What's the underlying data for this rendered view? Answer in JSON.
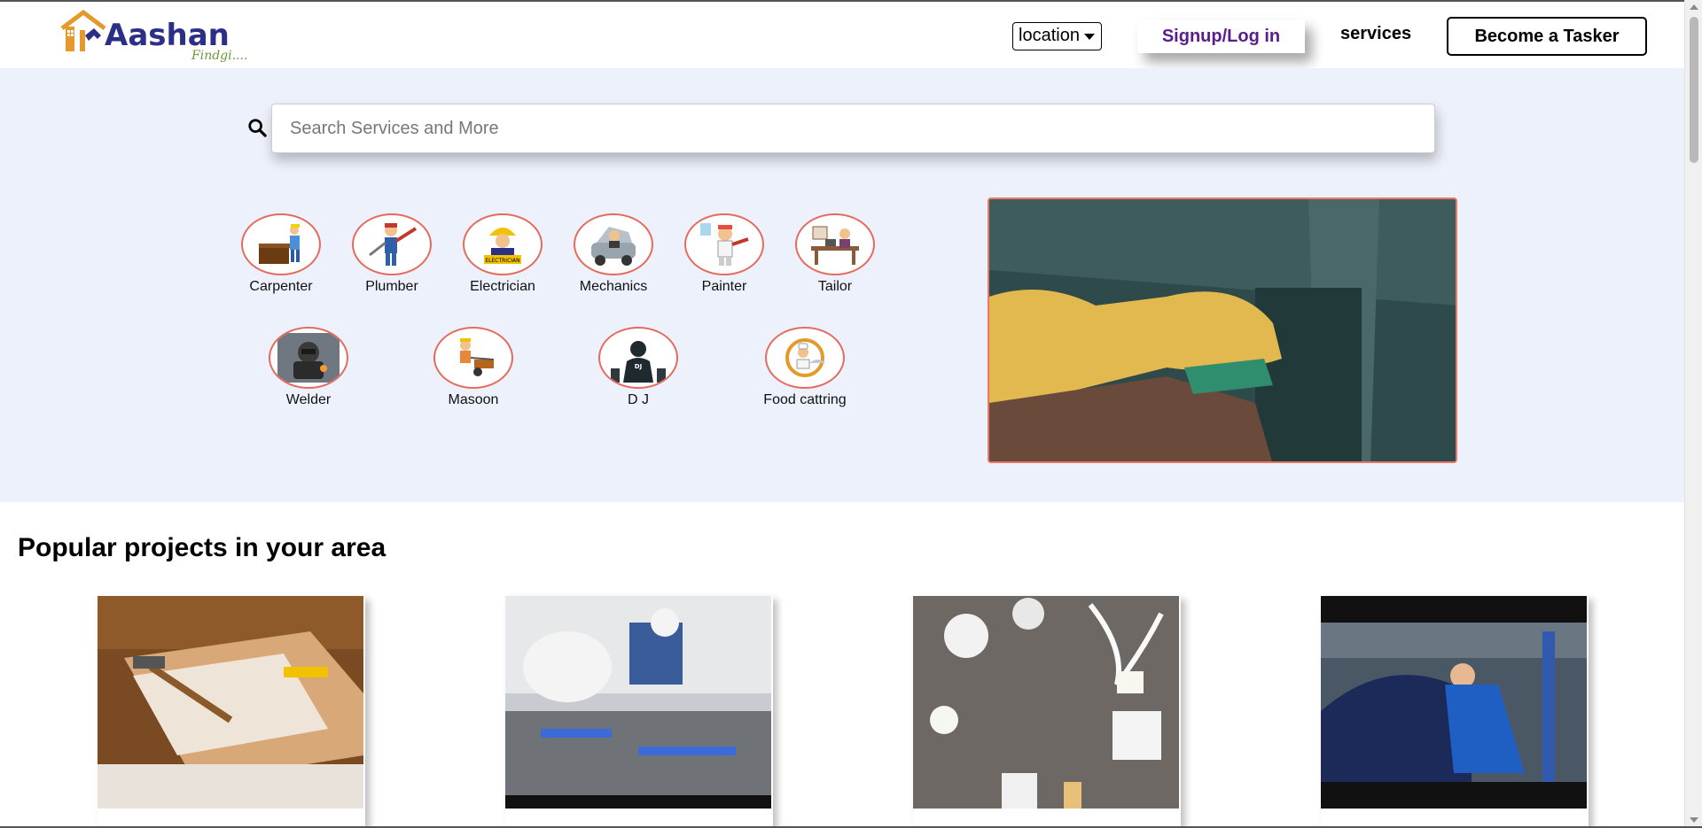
{
  "header": {
    "logo": {
      "name": "Aashan",
      "tagline": "Findgi...."
    },
    "location_label": "location",
    "signup_label": "Signup/Log in",
    "services_label": "services",
    "become_tasker_label": "Become a Tasker"
  },
  "search": {
    "placeholder": "Search Services and More",
    "icon": "search-icon"
  },
  "categories": [
    {
      "label": "Carpenter",
      "icon": "carpenter-icon"
    },
    {
      "label": "Plumber",
      "icon": "plumber-icon"
    },
    {
      "label": "Electrician",
      "icon": "electrician-icon"
    },
    {
      "label": "Mechanics",
      "icon": "mechanic-icon"
    },
    {
      "label": "Painter",
      "icon": "painter-icon"
    },
    {
      "label": "Tailor",
      "icon": "tailor-icon"
    },
    {
      "label": "Welder",
      "icon": "welder-icon"
    },
    {
      "label": "Masoon",
      "icon": "mason-icon"
    },
    {
      "label": "D J",
      "icon": "dj-icon"
    },
    {
      "label": "Food cattring",
      "icon": "food-catering-icon"
    }
  ],
  "popular": {
    "title": "Popular projects in your area",
    "projects": [
      {
        "image": "carpentry-tools-photo"
      },
      {
        "image": "plumber-at-work-photo"
      },
      {
        "image": "electrical-supplies-photo"
      },
      {
        "image": "car-mechanic-photo"
      }
    ]
  },
  "colors": {
    "brand_navy": "#2b2f86",
    "brand_green": "#6c9a3c",
    "brand_orange": "#e39a2a",
    "signup_purple": "#5a1e8c",
    "hero_background": "#edf1fb",
    "category_border": "#e56b5e"
  }
}
